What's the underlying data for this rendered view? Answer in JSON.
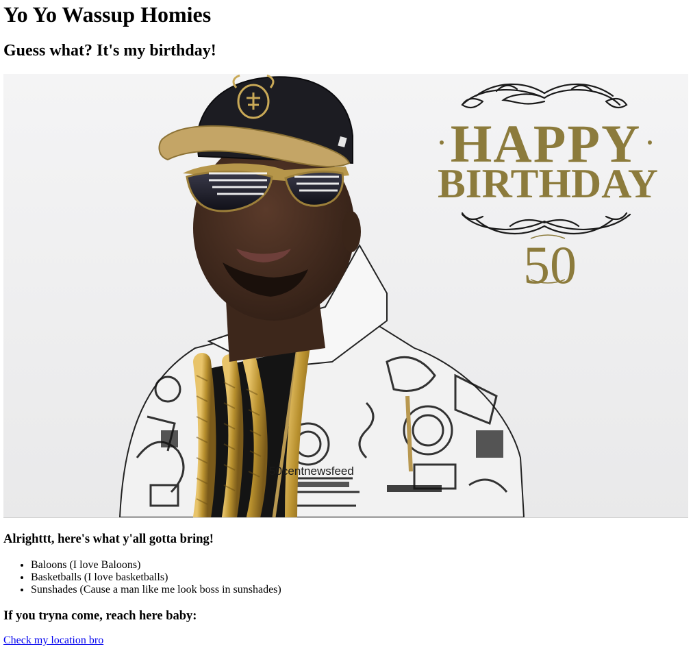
{
  "page": {
    "heading": "Yo Yo Wassup Homies",
    "subheading": "Guess what? It's my birthday!"
  },
  "hero_image": {
    "banner_line1": "HAPPY",
    "banner_line2": "BIRTHDAY",
    "banner_number": "50",
    "watermark": "50centnewsfeed",
    "colors": {
      "gold": "#8c7b3c",
      "background": "#efefef"
    }
  },
  "bring": {
    "heading": "Alrighttt, here's what y'all gotta bring!",
    "items": [
      "Baloons (I love Baloons)",
      "Basketballs (I love basketballs)",
      "Sunshades (Cause a man like me look boss in sunshades)"
    ]
  },
  "location": {
    "heading": "If you tryna come, reach here baby:",
    "link_text": "Check my location bro"
  }
}
